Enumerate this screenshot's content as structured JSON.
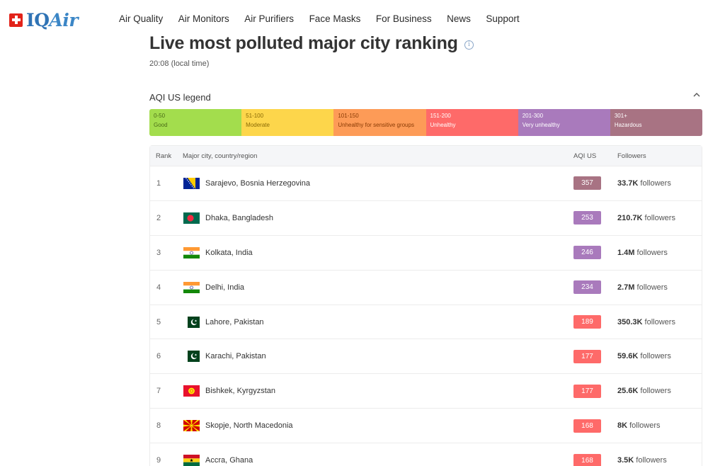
{
  "brand": {
    "logo_iq": "IQ",
    "logo_air": "Air"
  },
  "nav": [
    "Air Quality",
    "Air Monitors",
    "Air Purifiers",
    "Face Masks",
    "For Business",
    "News",
    "Support"
  ],
  "page": {
    "title": "Live most polluted major city ranking",
    "time": "20:08 (local time)",
    "info_glyph": "i"
  },
  "legend": {
    "title": "AQI US legend",
    "segments": [
      {
        "range": "0-50",
        "label": "Good",
        "color": "#a3dd4d",
        "text_color": "#4a6b17"
      },
      {
        "range": "51-100",
        "label": "Moderate",
        "color": "#fdd64b",
        "text_color": "#8a6a05"
      },
      {
        "range": "101-150",
        "label": "Unhealthy for sensitive groups",
        "color": "#fd9b57",
        "text_color": "#8a3b05"
      },
      {
        "range": "151-200",
        "label": "Unhealthy",
        "color": "#fe6a69",
        "text_color": "#ffffff"
      },
      {
        "range": "201-300",
        "label": "Very unhealthy",
        "color": "#a97abc",
        "text_color": "#ffffff"
      },
      {
        "range": "301+",
        "label": "Hazardous",
        "color": "#a87383",
        "text_color": "#ffffff"
      }
    ]
  },
  "table": {
    "headers": {
      "rank": "Rank",
      "city": "Major city, country/region",
      "aqi": "AQI US",
      "followers": "Followers"
    },
    "rows": [
      {
        "rank": "1",
        "city": "Sarajevo, Bosnia Herzegovina",
        "flag": "bosnia-flag",
        "aqi": "357",
        "aqi_color": "#a87383",
        "followers_count": "33.7K",
        "followers_suffix": " followers"
      },
      {
        "rank": "2",
        "city": "Dhaka, Bangladesh",
        "flag": "bangladesh-flag",
        "aqi": "253",
        "aqi_color": "#a97abc",
        "followers_count": "210.7K",
        "followers_suffix": " followers"
      },
      {
        "rank": "3",
        "city": "Kolkata, India",
        "flag": "india-flag",
        "aqi": "246",
        "aqi_color": "#a97abc",
        "followers_count": "1.4M",
        "followers_suffix": " followers"
      },
      {
        "rank": "4",
        "city": "Delhi, India",
        "flag": "india-flag",
        "aqi": "234",
        "aqi_color": "#a97abc",
        "followers_count": "2.7M",
        "followers_suffix": " followers"
      },
      {
        "rank": "5",
        "city": "Lahore, Pakistan",
        "flag": "pakistan-flag",
        "aqi": "189",
        "aqi_color": "#fe6a69",
        "followers_count": "350.3K",
        "followers_suffix": " followers"
      },
      {
        "rank": "6",
        "city": "Karachi, Pakistan",
        "flag": "pakistan-flag",
        "aqi": "177",
        "aqi_color": "#fe6a69",
        "followers_count": "59.6K",
        "followers_suffix": " followers"
      },
      {
        "rank": "7",
        "city": "Bishkek, Kyrgyzstan",
        "flag": "kyrgyzstan-flag",
        "aqi": "177",
        "aqi_color": "#fe6a69",
        "followers_count": "25.6K",
        "followers_suffix": " followers"
      },
      {
        "rank": "8",
        "city": "Skopje, North Macedonia",
        "flag": "north-macedonia-flag",
        "aqi": "168",
        "aqi_color": "#fe6a69",
        "followers_count": "8K",
        "followers_suffix": " followers"
      },
      {
        "rank": "9",
        "city": "Accra, Ghana",
        "flag": "ghana-flag",
        "aqi": "168",
        "aqi_color": "#fe6a69",
        "followers_count": "3.5K",
        "followers_suffix": " followers"
      }
    ]
  }
}
